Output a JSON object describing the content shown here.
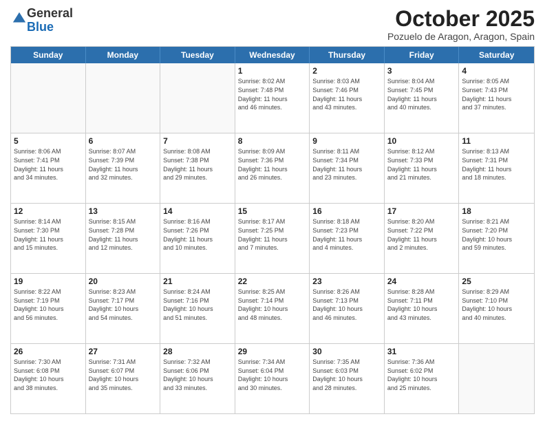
{
  "header": {
    "logo": {
      "line1": "General",
      "line2": "Blue"
    },
    "title": "October 2025",
    "location": "Pozuelo de Aragon, Aragon, Spain"
  },
  "dayHeaders": [
    "Sunday",
    "Monday",
    "Tuesday",
    "Wednesday",
    "Thursday",
    "Friday",
    "Saturday"
  ],
  "rows": [
    [
      {
        "date": "",
        "info": ""
      },
      {
        "date": "",
        "info": ""
      },
      {
        "date": "",
        "info": ""
      },
      {
        "date": "1",
        "info": "Sunrise: 8:02 AM\nSunset: 7:48 PM\nDaylight: 11 hours\nand 46 minutes."
      },
      {
        "date": "2",
        "info": "Sunrise: 8:03 AM\nSunset: 7:46 PM\nDaylight: 11 hours\nand 43 minutes."
      },
      {
        "date": "3",
        "info": "Sunrise: 8:04 AM\nSunset: 7:45 PM\nDaylight: 11 hours\nand 40 minutes."
      },
      {
        "date": "4",
        "info": "Sunrise: 8:05 AM\nSunset: 7:43 PM\nDaylight: 11 hours\nand 37 minutes."
      }
    ],
    [
      {
        "date": "5",
        "info": "Sunrise: 8:06 AM\nSunset: 7:41 PM\nDaylight: 11 hours\nand 34 minutes."
      },
      {
        "date": "6",
        "info": "Sunrise: 8:07 AM\nSunset: 7:39 PM\nDaylight: 11 hours\nand 32 minutes."
      },
      {
        "date": "7",
        "info": "Sunrise: 8:08 AM\nSunset: 7:38 PM\nDaylight: 11 hours\nand 29 minutes."
      },
      {
        "date": "8",
        "info": "Sunrise: 8:09 AM\nSunset: 7:36 PM\nDaylight: 11 hours\nand 26 minutes."
      },
      {
        "date": "9",
        "info": "Sunrise: 8:11 AM\nSunset: 7:34 PM\nDaylight: 11 hours\nand 23 minutes."
      },
      {
        "date": "10",
        "info": "Sunrise: 8:12 AM\nSunset: 7:33 PM\nDaylight: 11 hours\nand 21 minutes."
      },
      {
        "date": "11",
        "info": "Sunrise: 8:13 AM\nSunset: 7:31 PM\nDaylight: 11 hours\nand 18 minutes."
      }
    ],
    [
      {
        "date": "12",
        "info": "Sunrise: 8:14 AM\nSunset: 7:30 PM\nDaylight: 11 hours\nand 15 minutes."
      },
      {
        "date": "13",
        "info": "Sunrise: 8:15 AM\nSunset: 7:28 PM\nDaylight: 11 hours\nand 12 minutes."
      },
      {
        "date": "14",
        "info": "Sunrise: 8:16 AM\nSunset: 7:26 PM\nDaylight: 11 hours\nand 10 minutes."
      },
      {
        "date": "15",
        "info": "Sunrise: 8:17 AM\nSunset: 7:25 PM\nDaylight: 11 hours\nand 7 minutes."
      },
      {
        "date": "16",
        "info": "Sunrise: 8:18 AM\nSunset: 7:23 PM\nDaylight: 11 hours\nand 4 minutes."
      },
      {
        "date": "17",
        "info": "Sunrise: 8:20 AM\nSunset: 7:22 PM\nDaylight: 11 hours\nand 2 minutes."
      },
      {
        "date": "18",
        "info": "Sunrise: 8:21 AM\nSunset: 7:20 PM\nDaylight: 10 hours\nand 59 minutes."
      }
    ],
    [
      {
        "date": "19",
        "info": "Sunrise: 8:22 AM\nSunset: 7:19 PM\nDaylight: 10 hours\nand 56 minutes."
      },
      {
        "date": "20",
        "info": "Sunrise: 8:23 AM\nSunset: 7:17 PM\nDaylight: 10 hours\nand 54 minutes."
      },
      {
        "date": "21",
        "info": "Sunrise: 8:24 AM\nSunset: 7:16 PM\nDaylight: 10 hours\nand 51 minutes."
      },
      {
        "date": "22",
        "info": "Sunrise: 8:25 AM\nSunset: 7:14 PM\nDaylight: 10 hours\nand 48 minutes."
      },
      {
        "date": "23",
        "info": "Sunrise: 8:26 AM\nSunset: 7:13 PM\nDaylight: 10 hours\nand 46 minutes."
      },
      {
        "date": "24",
        "info": "Sunrise: 8:28 AM\nSunset: 7:11 PM\nDaylight: 10 hours\nand 43 minutes."
      },
      {
        "date": "25",
        "info": "Sunrise: 8:29 AM\nSunset: 7:10 PM\nDaylight: 10 hours\nand 40 minutes."
      }
    ],
    [
      {
        "date": "26",
        "info": "Sunrise: 7:30 AM\nSunset: 6:08 PM\nDaylight: 10 hours\nand 38 minutes."
      },
      {
        "date": "27",
        "info": "Sunrise: 7:31 AM\nSunset: 6:07 PM\nDaylight: 10 hours\nand 35 minutes."
      },
      {
        "date": "28",
        "info": "Sunrise: 7:32 AM\nSunset: 6:06 PM\nDaylight: 10 hours\nand 33 minutes."
      },
      {
        "date": "29",
        "info": "Sunrise: 7:34 AM\nSunset: 6:04 PM\nDaylight: 10 hours\nand 30 minutes."
      },
      {
        "date": "30",
        "info": "Sunrise: 7:35 AM\nSunset: 6:03 PM\nDaylight: 10 hours\nand 28 minutes."
      },
      {
        "date": "31",
        "info": "Sunrise: 7:36 AM\nSunset: 6:02 PM\nDaylight: 10 hours\nand 25 minutes."
      },
      {
        "date": "",
        "info": ""
      }
    ]
  ]
}
